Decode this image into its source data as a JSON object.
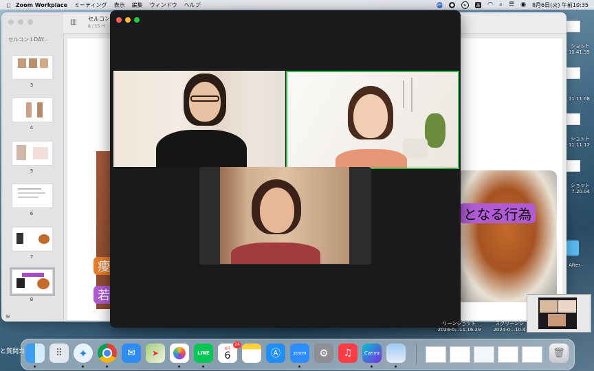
{
  "menubar": {
    "app_name": "Zoom Workplace",
    "menus": [
      "ミーティング",
      "表示",
      "編集",
      "ウィンドウ",
      "ヘルプ"
    ],
    "datetime": "8月6日(火) 午前10:35",
    "status_icons": [
      "zoom-status-icon",
      "screen-record-icon",
      "play-icon",
      "ime-icon",
      "wifi-icon",
      "search-icon",
      "control-center-icon",
      "siri-icon"
    ],
    "ime_label": "あ"
  },
  "preview": {
    "sidebar_title": "セルコン１DAY...",
    "doc_title": "セルコン",
    "doc_subtitle": "8 / 15 ペ",
    "page_numbers": [
      "3",
      "4",
      "5",
      "6",
      "7",
      "8"
    ],
    "selected_page": "8",
    "page_text_left_1": "痩",
    "page_text_left_2": "若",
    "page_text_right": "となる行為"
  },
  "left_edge_text": "と質問カ",
  "desktop_files": [
    {
      "label_1": "ショット",
      "label_2": "10.41.35"
    },
    {
      "label_1": "",
      "label_2": "11.11.08"
    },
    {
      "label_1": "ショット",
      "label_2": "11.11.12"
    },
    {
      "label_1": "ショット",
      "label_2": "7.20.04"
    },
    {
      "label_1": "After",
      "label_2": ""
    }
  ],
  "bottom_files": [
    {
      "label_1": "リーンショット",
      "label_2": "2024-0...11.16.29"
    },
    {
      "label_1": "スクリーンシ",
      "label_2": "2024-0...10.4"
    }
  ],
  "dock": {
    "apps": [
      "Finder",
      "Launchpad",
      "Safari",
      "Chrome",
      "Mail",
      "Maps",
      "Photos",
      "LINE",
      "Calendar",
      "Notes",
      "App Store",
      "Zoom",
      "System Settings",
      "Music",
      "Canva",
      "Preview"
    ],
    "calendar_month": "8月",
    "calendar_day": "6",
    "calendar_badge": "24",
    "line_label": "LINE",
    "zoom_label": "zoom",
    "canva_label": "Canva"
  },
  "colors": {
    "active_speaker_border": "#2db84a",
    "tag_orange": "#e97d2c",
    "tag_purple": "#b25bd6",
    "zoom_bg": "#1a1a1c"
  }
}
